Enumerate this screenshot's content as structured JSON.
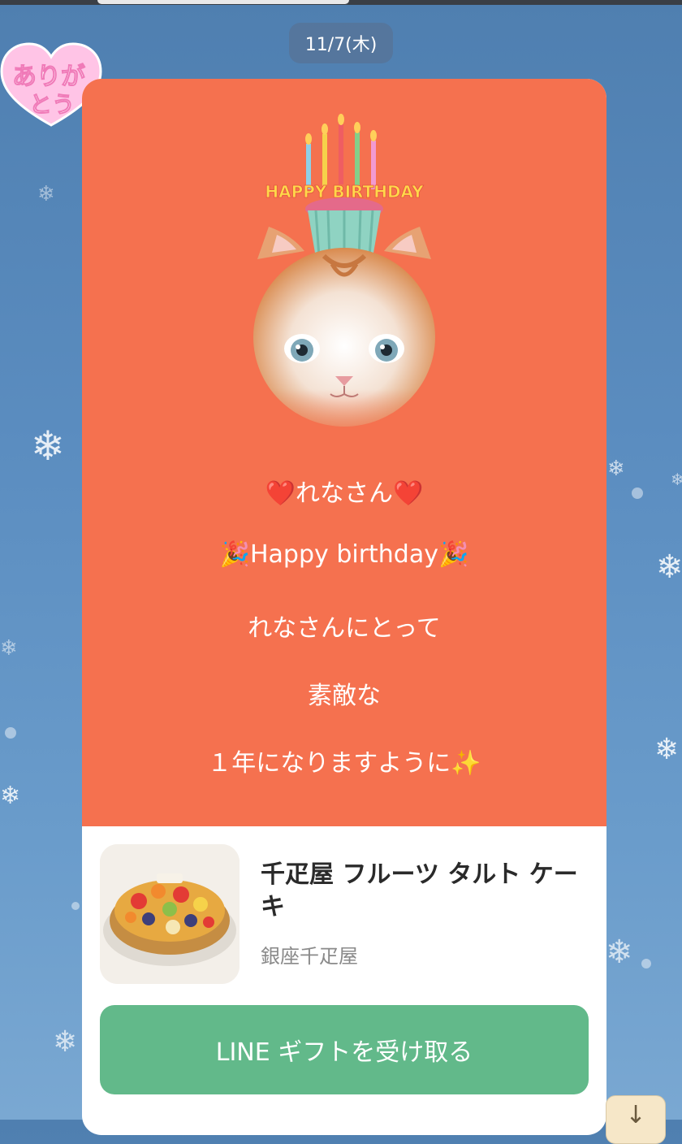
{
  "chat": {
    "date_label": "11/7(木)"
  },
  "sticker": {
    "text_line1": "ありが",
    "text_line2": "とう"
  },
  "card": {
    "cake_letters": "HAPPY BIRTHDAY",
    "message_lines": [
      "❤️れなさん❤️",
      "🎉Happy birthday🎉",
      "れなさんにとって",
      "素敵な",
      "１年になりますように✨"
    ],
    "product": {
      "name": "千疋屋 フルーツ タルト ケーキ",
      "brand": "銀座千疋屋",
      "thumb_icon": "fruit-tart-image"
    },
    "cta_label": "LINE ギフトを受け取る"
  },
  "scroll_button": {
    "icon": "arrow-down-icon",
    "glyph": "↓"
  },
  "colors": {
    "card_accent": "#f5714f",
    "cta_green": "#62b98a",
    "chat_background": "#5b8dc0"
  }
}
